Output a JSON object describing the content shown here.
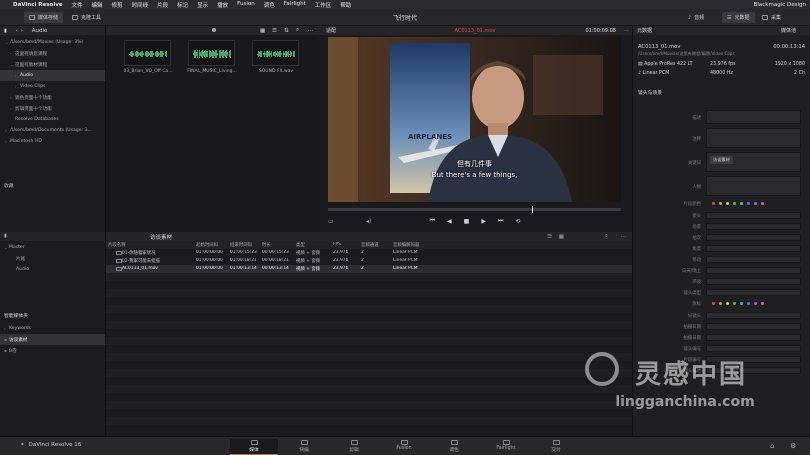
{
  "menubar": {
    "app": "DaVinci Resolve",
    "items": [
      "文件",
      "编辑",
      "修剪",
      "时间线",
      "片段",
      "标记",
      "显示",
      "播放",
      "Fusion",
      "调色",
      "Fairlight",
      "工作区",
      "帮助"
    ],
    "right": [
      "Blackmagic Design"
    ]
  },
  "toolbar": {
    "media_storage": "媒体存储",
    "clone_tool": "克隆工具",
    "project_name": "飞行时代",
    "audio": "音频",
    "metadata": "元数据",
    "capture": "采集"
  },
  "tree": {
    "header": "Audio",
    "rows": [
      {
        "label": "/Users/bmd/Movies (Usage: 3%)",
        "indent": 1,
        "caret": "⌄"
      },
      {
        "label": "这里有请您课程",
        "indent": 2,
        "caret": "›"
      },
      {
        "label": "这里有教材课程",
        "indent": 2,
        "caret": "⌄"
      },
      {
        "label": "Audio",
        "indent": 3,
        "caret": "›",
        "selected": true
      },
      {
        "label": "Video Clips",
        "indent": 3,
        "caret": "›"
      },
      {
        "label": "调色页面十个功能",
        "indent": 2,
        "caret": "›"
      },
      {
        "label": "剪辑页面十个功能",
        "indent": 2,
        "caret": "›"
      },
      {
        "label": "Resolve Databases",
        "indent": 2,
        "caret": ""
      },
      {
        "label": "/Users/bmd/Documents (Usage: 3...",
        "indent": 1,
        "caret": "›"
      },
      {
        "label": "Macintosh HD",
        "indent": 1,
        "caret": "›"
      }
    ],
    "favorites": "收藏"
  },
  "pool": {
    "thumbs": [
      {
        "label": "03_Brian_VO_Off Ca..."
      },
      {
        "label": "FINAL_MUSIC_Living..."
      },
      {
        "label": "SOUND FX.wav"
      }
    ]
  },
  "viewer": {
    "fit": "适配",
    "clip": "AC0113_01.mov",
    "timecode": "01:00:09:08",
    "subtitle_cn": "但有几件事",
    "subtitle_en": "But there's a few things,",
    "poster_text": "AIRPLANES",
    "transport": [
      "⏮",
      "◀",
      "■",
      "▶",
      "⏭",
      "⟲"
    ]
  },
  "inspector": {
    "tab": "元数据",
    "media_pool_label": "媒体池",
    "clip_name": "AC0113_01.mov",
    "clip_tc": "00:00:13:14",
    "path": "/Users/bmd/Movies/这里有教程/编教/Video Clips",
    "codec": "Apple ProRes 422 LT",
    "fps": "23.976 fps",
    "res": "1920 x 1080",
    "audio_codec": "Linear PCM",
    "audio_rate": "48000 Hz",
    "audio_ch": "2 Ch",
    "section": "镜头与场景",
    "labels": [
      "描述",
      "注释",
      "关键词",
      "人物",
      "片段颜色",
      "镜头",
      "场景",
      "拍次",
      "角度",
      "移动",
      "白天/晚上",
      "环境",
      "镜头类型",
      "旗标",
      "好镜头",
      "拍摄日期",
      "拍摄日期",
      "镜头编号",
      "片段编号",
      "镜头描述"
    ],
    "keyword_tag": "访谈素材",
    "swatches": [
      "#e05050",
      "#e0a040",
      "#e0d040",
      "#50c060",
      "#40c0c0",
      "#4080e0",
      "#a060e0",
      "#e060b0"
    ]
  },
  "bins": {
    "master": "Master",
    "items": [
      "片尾",
      "Audio"
    ],
    "smart": "智能媒体夹",
    "smart_items": [
      "Keywords",
      "访谈素材",
      "B卷"
    ]
  },
  "list": {
    "title": "访谈素材",
    "columns": [
      "片段名称",
      "起始时间码",
      "结束时间码",
      "时长",
      "类型",
      "FPS",
      "音频通道",
      "音频编解码器"
    ],
    "rows": [
      {
        "cells": [
          "01-你随着家状况",
          "01:00:00:00",
          "01:00:15:23",
          "00:00:15:23",
          "视频 + 音频",
          "23.976",
          "2",
          "Linear PCM"
        ],
        "selected": false
      },
      {
        "cells": [
          "02-我家可能去担描",
          "01:00:00:00",
          "01:00:18:21",
          "00:00:18:21",
          "视频 + 音频",
          "23.976",
          "2",
          "Linear PCM"
        ],
        "selected": false
      },
      {
        "cells": [
          "AC0113_01.mov",
          "01:00:00:00",
          "01:00:13:14",
          "00:00:13:14",
          "视频 + 音频",
          "23.976",
          "2",
          "Linear PCM"
        ],
        "selected": true
      }
    ]
  },
  "pages": [
    "媒体",
    "快编",
    "剪辑",
    "Fusion",
    "调色",
    "Fairlight",
    "交付"
  ],
  "active_page": "媒体",
  "brand_footer": "DaVinci Resolve 16",
  "watermark": {
    "cn": "灵感中国",
    "url": "lingganchina.com"
  }
}
